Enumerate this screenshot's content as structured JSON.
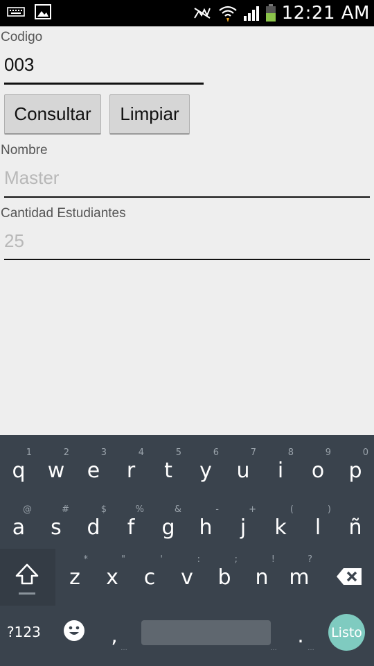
{
  "status_bar": {
    "time": "12:21 AM",
    "left_icons": [
      "keyboard-icon",
      "image-icon"
    ],
    "right_icons": [
      "nfc-muted-icon",
      "wifi-icon",
      "signal-icon",
      "battery-icon"
    ]
  },
  "form": {
    "codigo": {
      "label": "Codigo",
      "value": "003"
    },
    "buttons": {
      "consultar": "Consultar",
      "limpiar": "Limpiar"
    },
    "nombre": {
      "label": "Nombre",
      "value": "Master"
    },
    "cantidad": {
      "label": "Cantidad Estudiantes",
      "value": "25"
    }
  },
  "keyboard": {
    "row1": [
      {
        "k": "q",
        "h": "1"
      },
      {
        "k": "w",
        "h": "2"
      },
      {
        "k": "e",
        "h": "3"
      },
      {
        "k": "r",
        "h": "4"
      },
      {
        "k": "t",
        "h": "5"
      },
      {
        "k": "y",
        "h": "6"
      },
      {
        "k": "u",
        "h": "7"
      },
      {
        "k": "i",
        "h": "8"
      },
      {
        "k": "o",
        "h": "9"
      },
      {
        "k": "p",
        "h": "0"
      }
    ],
    "row2": [
      {
        "k": "a",
        "h": "@"
      },
      {
        "k": "s",
        "h": "#"
      },
      {
        "k": "d",
        "h": "$"
      },
      {
        "k": "f",
        "h": "%"
      },
      {
        "k": "g",
        "h": "&"
      },
      {
        "k": "h",
        "h": "-"
      },
      {
        "k": "j",
        "h": "+"
      },
      {
        "k": "k",
        "h": "("
      },
      {
        "k": "l",
        "h": ")"
      },
      {
        "k": "ñ",
        "h": ""
      }
    ],
    "row3": [
      {
        "k": "z",
        "h": "*"
      },
      {
        "k": "x",
        "h": "\""
      },
      {
        "k": "c",
        "h": "'"
      },
      {
        "k": "v",
        "h": ":"
      },
      {
        "k": "b",
        "h": ";"
      },
      {
        "k": "n",
        "h": "!"
      },
      {
        "k": "m",
        "h": "?"
      }
    ],
    "symbols_label": "?123",
    "comma": ",",
    "period": ".",
    "action_label": "Listo",
    "accent_color": "#7fcbc0"
  }
}
